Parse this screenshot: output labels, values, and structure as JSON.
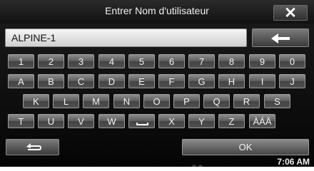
{
  "header": {
    "title": "Entrer Nom d'utilisateur",
    "close_label": "✕"
  },
  "input": {
    "value": "ALPINE-1"
  },
  "keyboard": {
    "rows": [
      [
        "1",
        "2",
        "3",
        "4",
        "5",
        "6",
        "7",
        "8",
        "9",
        "0"
      ],
      [
        "A",
        "B",
        "C",
        "D",
        "E",
        "F",
        "G",
        "H",
        "I",
        "J"
      ],
      [
        "K",
        "L",
        "M",
        "N",
        "O",
        "P",
        "Q",
        "R",
        "S"
      ],
      [
        "T",
        "U",
        "V",
        "W",
        "space-icon",
        "X",
        "Y",
        "Z",
        "ÀÁÄ"
      ]
    ]
  },
  "footer": {
    "ok_label": "OK"
  },
  "status": {
    "time": "7:06 AM"
  },
  "colors": {
    "background": "#0a0a0a",
    "key_top": "#8c8c8c",
    "key_bottom": "#444444",
    "text": "#f2f2f2",
    "input_bg": "#f6f6f6"
  }
}
